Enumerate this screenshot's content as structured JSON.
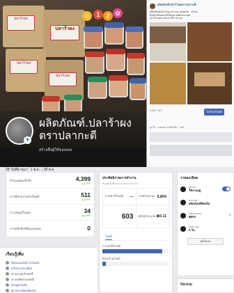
{
  "page": {
    "name": "ผลิตภัณฑ์.ปลาร้าผงตราปลากะตี",
    "subtitle": "สร้างชื่อผู้ใช้ของเพจ",
    "label_on_bag": "ปลาร้าผง"
  },
  "post_preview": {
    "title": "ผลิตภัณฑ์.ปลาร้าผงตราปลากะตี",
    "lines": [
      "ผลิตภัณฑ์ปลาร้าผง สะอาด ปลอดภัย · 19 ชม.",
      "สินค้าพร้อมส่ง สั่งได้เลย ส่งทั่วประเทศ",
      "ปลาร้าผงตราปลากะตี ราคาถูก"
    ],
    "stats": "5,818 · 527",
    "promote_button": "โปรโมทโพสต์",
    "comment_bar": "ถูกใจ · แสดงความคิดเห็น · แชร์"
  },
  "insights": {
    "period": "28 วันที่ผ่านมา : 1 พ.ย. – 28 พ.ย.",
    "stats": [
      {
        "label": "จำนวนคนเข้าถึง",
        "value": "4,399",
        "delta": "▲100%"
      },
      {
        "label": "การมีส่วนร่วมกับโพสต์",
        "value": "511",
        "delta": "▲100%"
      },
      {
        "label": "การกดถูกใจเพจ",
        "value": "34",
        "delta": "▲100%"
      },
      {
        "label": "การคลิกลิงก์ที่ปุ่มบนเพจ",
        "value": "0",
        "delta": ""
      }
    ]
  },
  "learn": {
    "title": "เรียนรู้เพิ่ม",
    "items": [
      {
        "text": "ปิดคอมเมนต์ภายในเพจ",
        "link": true
      },
      {
        "text": "แก้ไขรายละเอียด",
        "link": true
      },
      {
        "text": "92 คน ดูหน้าเพจนี้",
        "link": false
      },
      {
        "text": "52 คนติดตามเพจนี้",
        "link": false
      },
      {
        "text": "ปักหมุดโพสต์",
        "link": true
      },
      {
        "text": "ดูรายละเอียดเพิ่มเติม",
        "link": true
      }
    ]
  },
  "mid": {
    "title": "ประสิทธิภาพการทำงาน",
    "subtitle": "ข้อมูลเชิงลึกผ่านมาในช่วง 28 วัน",
    "cells": [
      {
        "label": "การเข้าถึงโพสต์",
        "value": "—"
      },
      {
        "label": "การมีส่วนร่วม",
        "value": "5,804"
      },
      {
        "label": "",
        "value": "603"
      },
      {
        "label": "คลิกทุกประเภท",
        "value": "฿0.11"
      }
    ],
    "tab": "โพสต์",
    "bars": [
      {
        "label": "การเข้าถึงโพสต์",
        "fraction": 0.9
      },
      {
        "label": "มีส่วนร่วมโพสต์",
        "fraction": 0.05
      }
    ]
  },
  "about": {
    "title": "รายละเอียด",
    "items": [
      {
        "label": "สถานะ",
        "value": "ใช้งานอยู่",
        "control": "toggle"
      },
      {
        "label": "ประเภท",
        "value": "ผลิตภัณฑ์ท้องถิ่น",
        "control": ""
      },
      {
        "label": "งบประมาณ",
        "value": "฿800",
        "control": "pencil"
      },
      {
        "label": "ระยะเวลา",
        "value": "5 วัน",
        "control": ""
      }
    ],
    "button": "ดูทั้งหมด",
    "footer_title": "กิจกรรม"
  },
  "colors": {
    "facebook_blue": "#4267b2",
    "positive": "#42b72a",
    "label_red": "#aa1111"
  }
}
